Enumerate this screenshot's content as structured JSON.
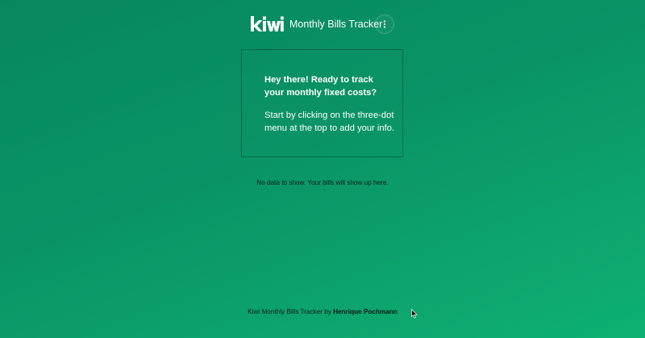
{
  "header": {
    "logo_text": "kiwi",
    "title": "Monthly Bills Tracker",
    "menu_icon": "more-vertical-icon"
  },
  "welcome_card": {
    "heading": "Hey there! Ready to track your monthly fixed costs?",
    "body": "Start by clicking on the three-dot menu at the top to add your info."
  },
  "empty_state": {
    "message": "No data to show. Your bills will show up here."
  },
  "footer": {
    "prefix": "Kiwi Monthly Bills Tracker by",
    "author": "Henrique Pochmann"
  },
  "colors": {
    "background_start": "#07875f",
    "background_end": "#0fb173",
    "text_light": "#ffffff",
    "text_dark": "#0b1a14"
  }
}
